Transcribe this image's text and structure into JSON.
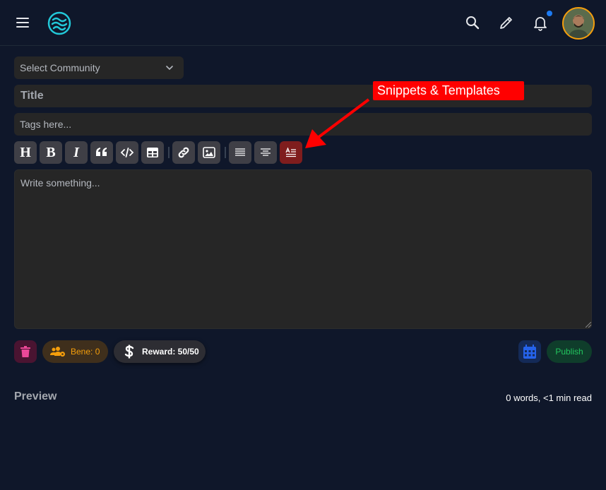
{
  "header": {
    "menu_icon": "hamburger-icon",
    "logo_icon": "waves-logo-icon",
    "search_icon": "search-icon",
    "compose_icon": "pencil-icon",
    "notifications_icon": "bell-icon",
    "notification_dot_color": "#1d7bf2",
    "avatar_ring_color": "#f59e0b"
  },
  "form": {
    "community_select": "Select Community",
    "title_placeholder": "Title",
    "tags_placeholder": "Tags here...",
    "body_placeholder": "Write something..."
  },
  "toolbar": {
    "buttons": [
      {
        "icon": "heading-icon",
        "glyph": "H"
      },
      {
        "icon": "bold-icon",
        "glyph": "B"
      },
      {
        "icon": "italic-icon",
        "glyph": "I"
      },
      {
        "icon": "quote-icon"
      },
      {
        "icon": "code-icon"
      },
      {
        "icon": "table-icon"
      },
      {
        "icon": "link-icon"
      },
      {
        "icon": "image-icon"
      },
      {
        "icon": "align-justify-icon"
      },
      {
        "icon": "align-center-icon"
      },
      {
        "icon": "snippets-templates-icon",
        "active": true
      }
    ]
  },
  "annotation": {
    "callout_text": "Snippets & Templates",
    "color": "#ff0000"
  },
  "actions": {
    "bene_label": "Bene: 0",
    "reward_label": "Reward: 50/50",
    "publish_label": "Publish"
  },
  "footer": {
    "preview_label": "Preview",
    "word_count": "0 words, <1 min read"
  }
}
